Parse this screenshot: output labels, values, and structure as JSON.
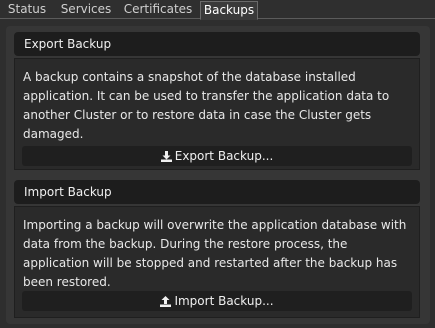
{
  "tabs": [
    {
      "label": "Status",
      "active": false
    },
    {
      "label": "Services",
      "active": false
    },
    {
      "label": "Certificates",
      "active": false
    },
    {
      "label": "Backups",
      "active": true
    }
  ],
  "export": {
    "title": "Export Backup",
    "description": "A backup contains a snapshot of the database installed application. It can be used to transfer the application data to another Cluster or to restore data in case the Cluster gets damaged.",
    "button_label": "Export Backup...",
    "button_icon": "download-icon"
  },
  "import": {
    "title": "Import Backup",
    "description": "Importing a backup will overwrite the application database with data from the backup. During the restore process, the application will be stopped and restarted after the backup has been restored.",
    "button_label": "Import Backup...",
    "button_icon": "upload-icon"
  },
  "colors": {
    "background": "#2e2e2e",
    "header": "#1d1d1d",
    "body": "#2a2a2a",
    "text": "#e8e8e8"
  }
}
